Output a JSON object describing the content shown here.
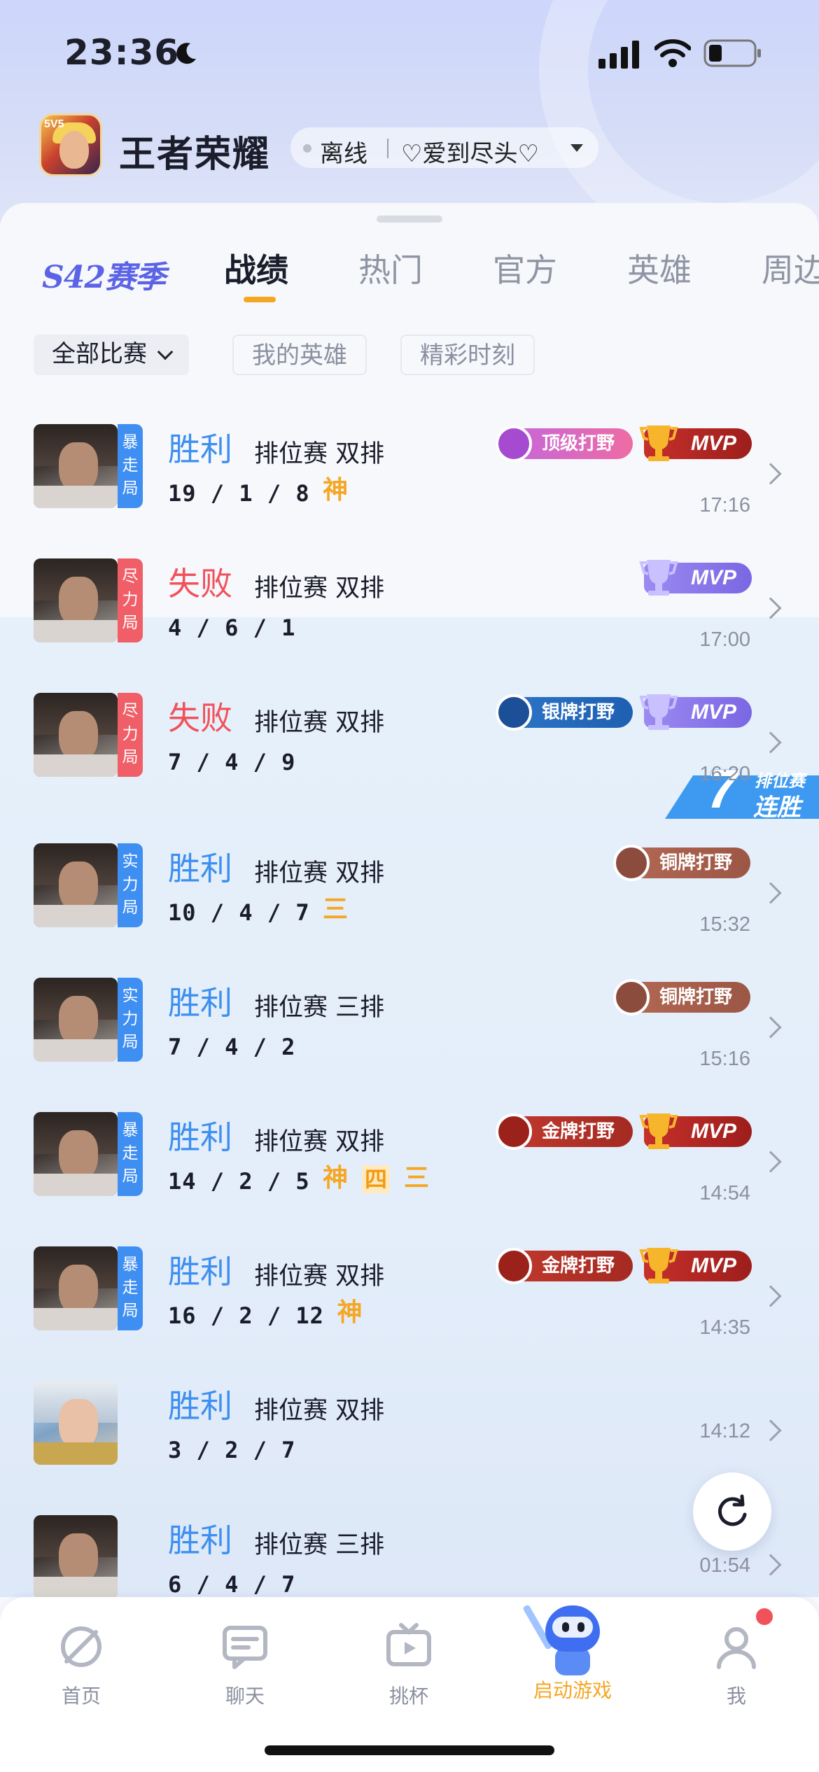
{
  "status_bar": {
    "time": "23:36"
  },
  "header": {
    "title": "王者荣耀",
    "status": "离线",
    "motto": "♡爱到尽头♡"
  },
  "season": "S42赛季",
  "tabs": [
    "战绩",
    "热门",
    "官方",
    "英雄",
    "周边"
  ],
  "filters": {
    "all_matches": "全部比赛",
    "my_heroes": "我的英雄",
    "highlights": "精彩时刻"
  },
  "streak": {
    "number": "7",
    "top": "排位赛",
    "bottom": "连胜"
  },
  "matches": [
    {
      "tag": "暴走局",
      "tag_color": "#3f8ef2",
      "result": "胜利",
      "outcome": "win",
      "mode": "排位赛 双排",
      "kda": "19 / 1 / 8",
      "feats": [
        "神"
      ],
      "badge": "顶级打野",
      "badge_style": "pink",
      "mvp": "MVP",
      "mvp_style": "gold",
      "time": "17:16"
    },
    {
      "tag": "尽力局",
      "tag_color": "#f05f68",
      "result": "失败",
      "outcome": "lose",
      "mode": "排位赛 双排",
      "kda": "4 / 6 / 1",
      "feats": [],
      "badge": "",
      "mvp": "MVP",
      "mvp_style": "purple",
      "time": "17:00"
    },
    {
      "tag": "尽力局",
      "tag_color": "#f05f68",
      "result": "失败",
      "outcome": "lose",
      "mode": "排位赛 双排",
      "kda": "7 / 4 / 9",
      "feats": [],
      "badge": "银牌打野",
      "badge_style": "silver",
      "mvp": "MVP",
      "mvp_style": "purple",
      "time": "16:20"
    },
    {
      "tag": "实力局",
      "tag_color": "#3f8ef2",
      "result": "胜利",
      "outcome": "win",
      "mode": "排位赛 双排",
      "kda": "10 / 4 / 7",
      "feats": [
        "三"
      ],
      "badge": "铜牌打野",
      "badge_style": "bronze",
      "mvp": "",
      "time": "15:32"
    },
    {
      "tag": "实力局",
      "tag_color": "#3f8ef2",
      "result": "胜利",
      "outcome": "win",
      "mode": "排位赛 三排",
      "kda": "7 / 4 / 2",
      "feats": [],
      "badge": "铜牌打野",
      "badge_style": "bronze",
      "mvp": "",
      "time": "15:16"
    },
    {
      "tag": "暴走局",
      "tag_color": "#3f8ef2",
      "result": "胜利",
      "outcome": "win",
      "mode": "排位赛 双排",
      "kda": "14 / 2 / 5",
      "feats": [
        "神",
        "四",
        "三"
      ],
      "badge": "金牌打野",
      "badge_style": "gold",
      "mvp": "MVP",
      "mvp_style": "gold",
      "time": "14:54"
    },
    {
      "tag": "暴走局",
      "tag_color": "#3f8ef2",
      "result": "胜利",
      "outcome": "win",
      "mode": "排位赛 双排",
      "kda": "16 / 2 / 12",
      "feats": [
        "神"
      ],
      "badge": "金牌打野",
      "badge_style": "gold",
      "mvp": "MVP",
      "mvp_style": "gold",
      "time": "14:35"
    },
    {
      "tag": "",
      "result": "胜利",
      "outcome": "win",
      "mode": "排位赛 双排",
      "kda": "3 / 2 / 7",
      "feats": [],
      "badge": "",
      "mvp": "",
      "time": "14:12"
    },
    {
      "tag": "",
      "result": "胜利",
      "outcome": "win",
      "mode": "排位赛 三排",
      "kda": "6 / 4 / 7",
      "feats": [],
      "badge": "",
      "mvp": "",
      "time": "01:54"
    }
  ],
  "bottom_nav": [
    "首页",
    "聊天",
    "挑杯",
    "启动游戏",
    "我"
  ]
}
